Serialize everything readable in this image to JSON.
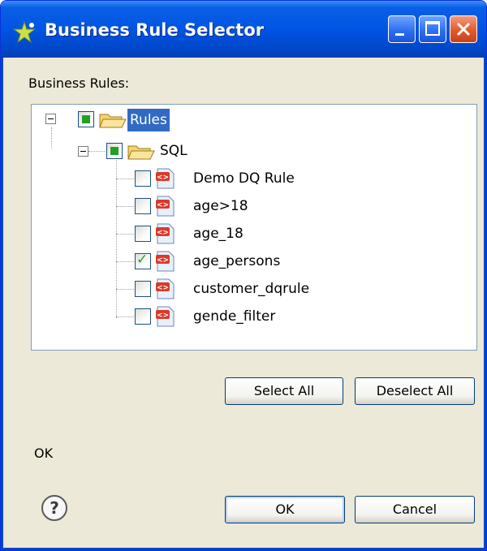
{
  "window": {
    "title": "Business Rule Selector"
  },
  "labels": {
    "business_rules": "Business Rules:",
    "status": "OK"
  },
  "tree": {
    "root": {
      "label": "Rules",
      "expanded": true,
      "selected": true,
      "check": "partial"
    },
    "folder": {
      "label": "SQL",
      "expanded": true,
      "check": "partial"
    },
    "items": [
      {
        "label": "Demo DQ Rule",
        "checked": false
      },
      {
        "label": "age>18",
        "checked": false
      },
      {
        "label": "age_18",
        "checked": false
      },
      {
        "label": "age_persons",
        "checked": true
      },
      {
        "label": "customer_dqrule",
        "checked": false
      },
      {
        "label": "gende_filter",
        "checked": false
      }
    ]
  },
  "buttons": {
    "select_all": "Select All",
    "deselect_all": "Deselect All",
    "ok": "OK",
    "cancel": "Cancel"
  },
  "colors": {
    "title_bar": "#0054e3",
    "dialog_bg": "#ece9d8",
    "selection": "#316ac5",
    "check": "#21a121"
  }
}
